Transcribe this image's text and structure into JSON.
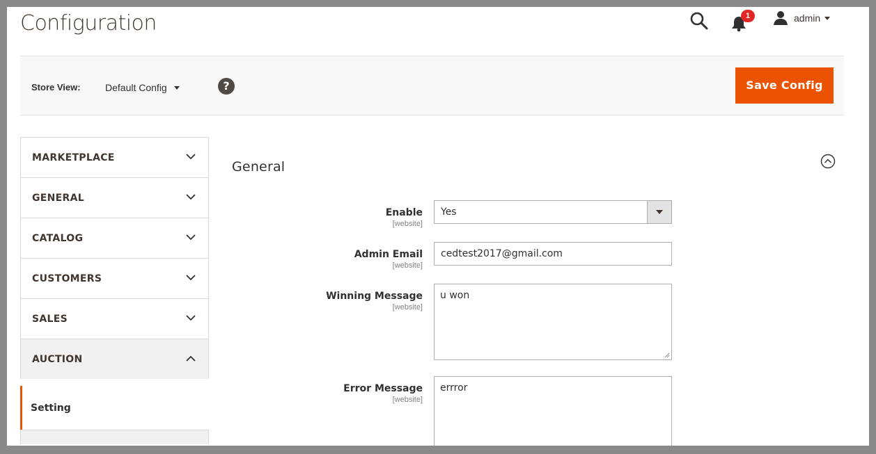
{
  "header": {
    "title": "Configuration",
    "notification_count": "1",
    "user_name": "admin"
  },
  "store_bar": {
    "label": "Store View:",
    "selected": "Default Config",
    "help_glyph": "?",
    "save_label": "Save Config"
  },
  "sidebar": {
    "items": [
      {
        "label": "MARKETPLACE"
      },
      {
        "label": "GENERAL"
      },
      {
        "label": "CATALOG"
      },
      {
        "label": "CUSTOMERS"
      },
      {
        "label": "SALES"
      },
      {
        "label": "AUCTION"
      }
    ],
    "sub_item": "Setting"
  },
  "section": {
    "title": "General"
  },
  "fields": {
    "enable": {
      "label": "Enable",
      "scope": "[website]",
      "value": "Yes"
    },
    "admin_email": {
      "label": "Admin Email",
      "scope": "[website]",
      "value": "cedtest2017@gmail.com"
    },
    "winning_message": {
      "label": "Winning Message",
      "scope": "[website]",
      "value": "u won"
    },
    "error_message": {
      "label": "Error Message",
      "scope": "[website]",
      "value": "errror"
    }
  },
  "colors": {
    "accent": "#eb5202",
    "badge": "#e22626",
    "text": "#303030"
  },
  "icons": [
    "search-icon",
    "bell-icon",
    "user-icon",
    "help-icon",
    "chevron-down-icon",
    "chevron-up-icon",
    "collapse-circle-icon"
  ]
}
